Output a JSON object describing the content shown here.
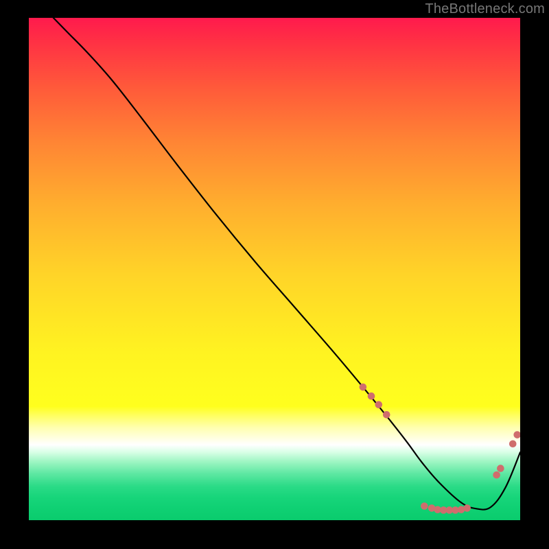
{
  "watermark": "TheBottleneck.com",
  "chart_data": {
    "type": "line",
    "title": "",
    "xlabel": "",
    "ylabel": "",
    "xlim": [
      0,
      100
    ],
    "ylim": [
      0,
      100
    ],
    "grid": false,
    "legend": false,
    "background": {
      "gradient_stops": [
        {
          "pos": 0.0,
          "color": "#ff1a4d"
        },
        {
          "pos": 0.2,
          "color": "#ff6a38"
        },
        {
          "pos": 0.4,
          "color": "#ffb02e"
        },
        {
          "pos": 0.6,
          "color": "#ffe524"
        },
        {
          "pos": 0.775,
          "color": "#ffff22"
        },
        {
          "pos": 0.85,
          "color": "#ffffff"
        },
        {
          "pos": 0.92,
          "color": "#6fe9aa"
        },
        {
          "pos": 1.0,
          "color": "#0acc6d"
        }
      ]
    },
    "series": [
      {
        "name": "curve",
        "color": "#000000",
        "x": [
          5,
          8,
          12,
          17,
          23,
          30,
          38,
          46,
          54,
          62,
          68,
          73,
          77,
          80,
          83.5,
          88,
          91,
          94,
          97,
          100
        ],
        "values": [
          100,
          97,
          93,
          87.5,
          80,
          71,
          61,
          51.5,
          42.5,
          33.5,
          26.5,
          20.5,
          15.5,
          11.5,
          7.5,
          3.5,
          2.3,
          2.6,
          6.5,
          13.5
        ]
      }
    ],
    "points": [
      {
        "name": "p1",
        "x": 68.0,
        "y": 26.5
      },
      {
        "name": "p2",
        "x": 69.7,
        "y": 24.7
      },
      {
        "name": "p3",
        "x": 71.2,
        "y": 23.0
      },
      {
        "name": "p4",
        "x": 72.8,
        "y": 21.0
      },
      {
        "name": "p5",
        "x": 80.5,
        "y": 2.8
      },
      {
        "name": "p6",
        "x": 82.0,
        "y": 2.4
      },
      {
        "name": "p7",
        "x": 83.2,
        "y": 2.1
      },
      {
        "name": "p8",
        "x": 84.4,
        "y": 2.0
      },
      {
        "name": "p9",
        "x": 85.6,
        "y": 2.0
      },
      {
        "name": "p10",
        "x": 86.8,
        "y": 2.0
      },
      {
        "name": "p11",
        "x": 88.0,
        "y": 2.1
      },
      {
        "name": "p12",
        "x": 89.2,
        "y": 2.4
      },
      {
        "name": "p13",
        "x": 95.2,
        "y": 9.0
      },
      {
        "name": "p14",
        "x": 96.0,
        "y": 10.3
      },
      {
        "name": "p15",
        "x": 98.5,
        "y": 15.2
      },
      {
        "name": "p16",
        "x": 99.4,
        "y": 17.0
      }
    ],
    "point_color": "#cf6d6d",
    "point_radius": 5.3
  }
}
